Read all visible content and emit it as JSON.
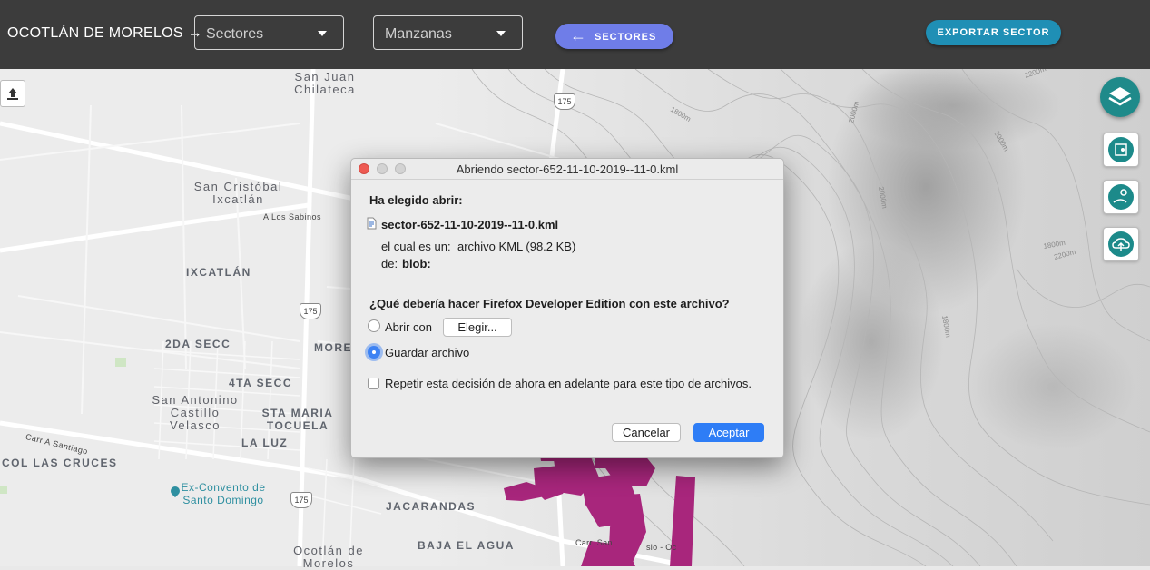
{
  "header": {
    "place": "OCOTLÁN DE MORELOS →",
    "select_sectores": "Sectores",
    "select_manzanas": "Manzanas",
    "sectores_button": "SECTORES",
    "export_button": "EXPORTAR SECTOR"
  },
  "map": {
    "labels": {
      "san_juan_chilateca_1": "San Juan",
      "san_juan_chilateca_2": "Chilateca",
      "san_cristobal_1": "San Cristóbal",
      "san_cristobal_2": "Ixcatlán",
      "a_los_sabinos": "A Los Sabinos",
      "ixcatlan": "IXCATLÁN",
      "segunda_secc": "2DA SECC",
      "more": "MORE",
      "cuarta_secc": "4TA SECC",
      "san_antonino_1": "San Antonino",
      "san_antonino_2": "Castillo",
      "san_antonino_3": "Velasco",
      "sta_maria_1": "STA MARIA",
      "sta_maria_2": "TOCUELA",
      "la_luz": "LA LUZ",
      "carr_santiago": "Carr A Santiago",
      "col_las_cruces": "COL LAS CRUCES",
      "ex_convento_1": "Ex-Convento de",
      "ex_convento_2": "Santo Domingo",
      "jacarandas": "JACARANDAS",
      "baja_el_agua": "BAJA EL AGUA",
      "ocotlan_1": "Ocotlán de",
      "ocotlan_2": "Morelos",
      "carr_san": "Carr. San",
      "sio_oc": "sio - Oc",
      "contour_1800a": "1800m",
      "contour_2200a": "2200m",
      "contour_2000a": "2000m",
      "contour_2000b": "2000m",
      "contour_2200b": "2200m",
      "contour_1800b": "1800m",
      "contour_1800c": "1800m",
      "contour_2000c": "2000m"
    },
    "route_175": "175"
  },
  "dialog": {
    "title": "Abriendo sector-652-11-10-2019--11-0.kml",
    "chosen_label": "Ha elegido abrir:",
    "filename": "sector-652-11-10-2019--11-0.kml",
    "which_is_label": "el cual es un:",
    "which_is_value": "archivo KML (98.2 KB)",
    "from_label": "de:",
    "from_value": "blob:",
    "question": "¿Qué debería hacer Firefox Developer Edition con este archivo?",
    "open_with_label": "Abrir con",
    "choose_button": "Elegir...",
    "save_label": "Guardar archivo",
    "selected_option": "Guardar archivo",
    "repeat_label": "Repetir esta decisión de ahora en adelante para este tipo de archivos.",
    "cancel_button": "Cancelar",
    "accept_button": "Aceptar"
  },
  "colors": {
    "header_bg": "#3c3c3c",
    "sectores_button": "#6f7de8",
    "export_button": "#1f8fb5",
    "tool_accent": "#1c8a8a",
    "sector_shape": "#a8267c",
    "accept_button": "#2e7df6"
  },
  "icons": {
    "upload": "upload-icon",
    "layers": "layers-icon",
    "map_tool": "map-icon",
    "location_tool": "location-route-icon",
    "cloud_tool": "cloud-upload-icon",
    "back_arrow": "arrow-left-icon",
    "file": "file-icon"
  }
}
